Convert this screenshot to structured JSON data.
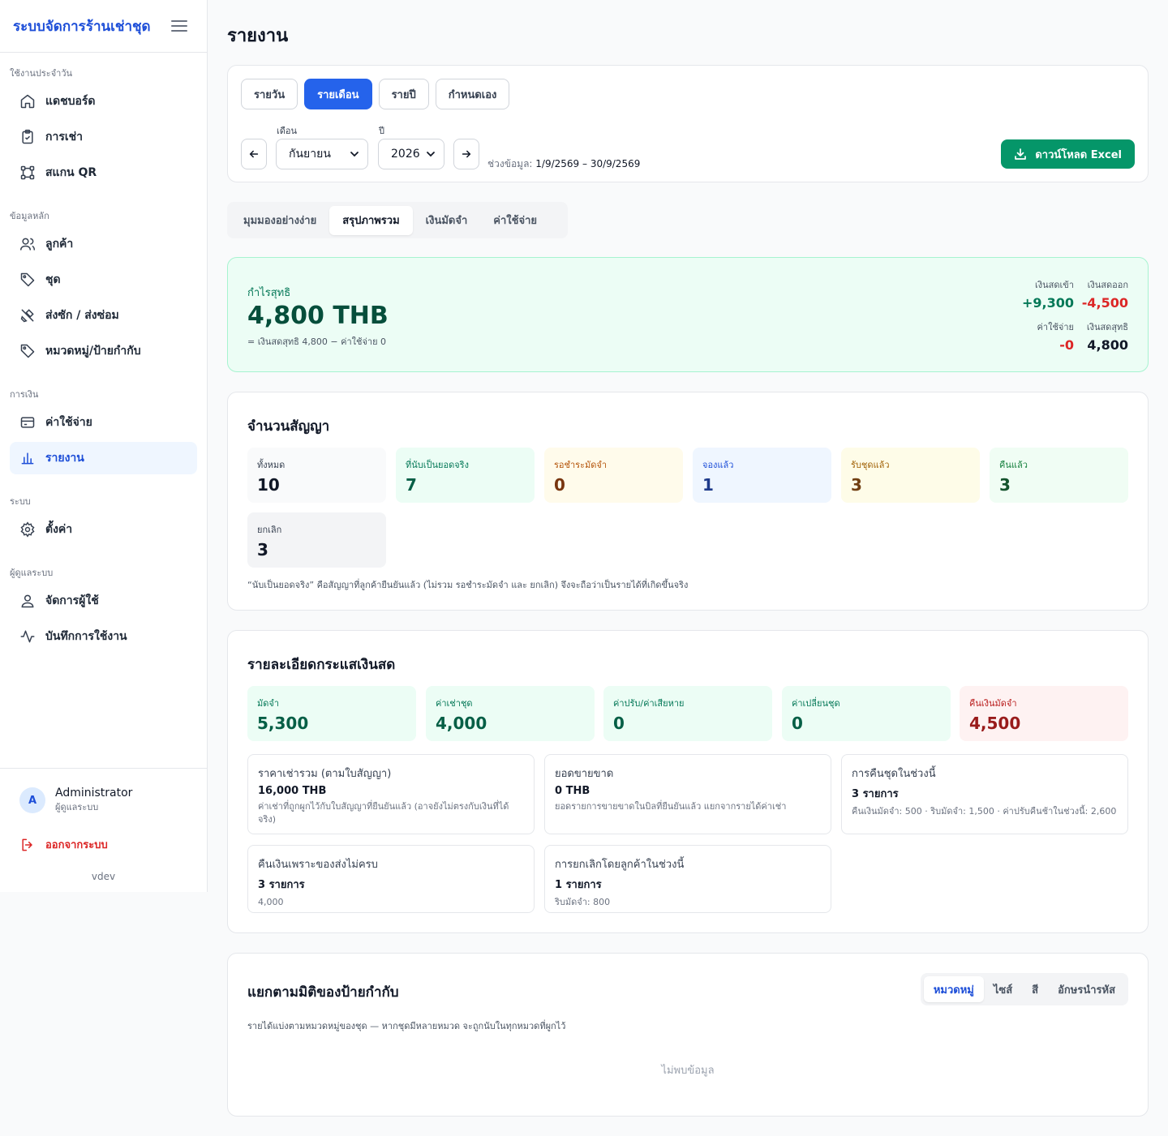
{
  "sidebar": {
    "brand": "ระบบจัดการร้านเช่าชุด",
    "sections": {
      "daily": "ใช้งานประจำวัน",
      "master": "ข้อมูลหลัก",
      "finance": "การเงิน",
      "system": "ระบบ",
      "admin": "ผู้ดูแลระบบ"
    },
    "items": {
      "dashboard": "แดชบอร์ด",
      "rentals": "การเช่า",
      "scan": "สแกน QR",
      "customers": "ลูกค้า",
      "outfits": "ชุด",
      "laundry": "ส่งซัก / ส่งซ่อม",
      "categories": "หมวดหมู่/ป้ายกำกับ",
      "expenses": "ค่าใช้จ่าย",
      "reports": "รายงาน",
      "settings": "ตั้งค่า",
      "users": "จัดการผู้ใช้",
      "activity": "บันทึกการใช้งาน"
    },
    "user": {
      "initial": "A",
      "name": "Administrator",
      "role": "ผู้ดูแลระบบ"
    },
    "logout": "ออกจากระบบ",
    "version": "vdev"
  },
  "page": {
    "title": "รายงาน"
  },
  "period": {
    "tabs": [
      "รายวัน",
      "รายเดือน",
      "รายปี",
      "กำหนดเอง"
    ],
    "active_tab": "รายเดือน",
    "month_label": "เดือน",
    "month_value": "กันยายน",
    "year_label": "ปี",
    "year_value": "2026",
    "range_label": "ช่วงข้อมูล:",
    "range_value": "1/9/2569 – 30/9/2569",
    "excel_button": "ดาวน์โหลด Excel"
  },
  "views": {
    "tabs": [
      "มุมมองอย่างง่าย",
      "สรุปภาพรวม",
      "เงินมัดจำ",
      "ค่าใช้จ่าย"
    ],
    "active": "สรุปภาพรวม"
  },
  "profit": {
    "label": "กำไรสุทธิ",
    "value": "4,800 THB",
    "formula": "= เงินสดสุทธิ 4,800 − ค่าใช้จ่าย 0",
    "cash_in_label": "เงินสดเข้า",
    "cash_in": "+9,300",
    "cash_out_label": "เงินสดออก",
    "cash_out": "-4,500",
    "expense_label": "ค่าใช้จ่าย",
    "expense": "-0",
    "net_cash_label": "เงินสดสุทธิ",
    "net_cash": "4,800"
  },
  "contracts": {
    "title": "จำนวนสัญญา",
    "tiles": [
      {
        "label": "ทั้งหมด",
        "value": "10"
      },
      {
        "label": "ที่นับเป็นยอดจริง",
        "value": "7"
      },
      {
        "label": "รอชำระมัดจำ",
        "value": "0"
      },
      {
        "label": "จองแล้ว",
        "value": "1"
      },
      {
        "label": "รับชุดแล้ว",
        "value": "3"
      },
      {
        "label": "คืนแล้ว",
        "value": "3"
      },
      {
        "label": "ยกเลิก",
        "value": "3"
      }
    ],
    "note": "“นับเป็นยอดจริง” คือสัญญาที่ลูกค้ายืนยันแล้ว (ไม่รวม รอชำระมัดจำ และ ยกเลิก) จึงจะถือว่าเป็นรายได้ที่เกิดขึ้นจริง"
  },
  "cashflow": {
    "title": "รายละเอียดกระแสเงินสด",
    "tiles": [
      {
        "label": "มัดจำ",
        "value": "5,300"
      },
      {
        "label": "ค่าเช่าชุด",
        "value": "4,000"
      },
      {
        "label": "ค่าปรับ/ค่าเสียหาย",
        "value": "0"
      },
      {
        "label": "ค่าเปลี่ยนชุด",
        "value": "0"
      },
      {
        "label": "คืนเงินมัดจำ",
        "value": "4,500"
      }
    ],
    "boxes": [
      {
        "title": "ราคาเช่ารวม (ตามใบสัญญา)",
        "value": "16,000 THB",
        "desc": "ค่าเช่าที่ถูกผูกไว้กับใบสัญญาที่ยืนยันแล้ว (อาจยังไม่ตรงกับเงินที่ได้จริง)"
      },
      {
        "title": "ยอดขายขาด",
        "value": "0 THB",
        "desc": "ยอดรายการขายขาดในบิลที่ยืนยันแล้ว แยกจากรายได้ค่าเช่า"
      },
      {
        "title": "การคืนชุดในช่วงนี้",
        "value": "3 รายการ",
        "desc": "คืนเงินมัดจำ: 500 · ริบมัดจำ: 1,500 · ค่าปรับคืนช้าในช่วงนี้: 2,600"
      },
      {
        "title": "คืนเงินเพราะของส่งไม่ครบ",
        "value": "3 รายการ",
        "desc": "4,000"
      },
      {
        "title": "การยกเลิกโดยลูกค้าในช่วงนี้",
        "value": "1 รายการ",
        "desc": "ริบมัดจำ: 800"
      }
    ]
  },
  "tags": {
    "title": "แยกตามมิติของป้ายกำกับ",
    "tabs": [
      "หมวดหมู่",
      "ไซส์",
      "สี",
      "อักษรนำรหัส"
    ],
    "active": "หมวดหมู่",
    "desc": "รายได้แบ่งตามหมวดหมู่ของชุด — หากชุดมีหลายหมวด จะถูกนับในทุกหมวดที่ผูกไว้",
    "empty": "ไม่พบข้อมูล"
  },
  "colors": {
    "primary": "#2563eb",
    "success": "#059669",
    "danger": "#dc2626",
    "profit_bg": "#ecfdf5"
  }
}
